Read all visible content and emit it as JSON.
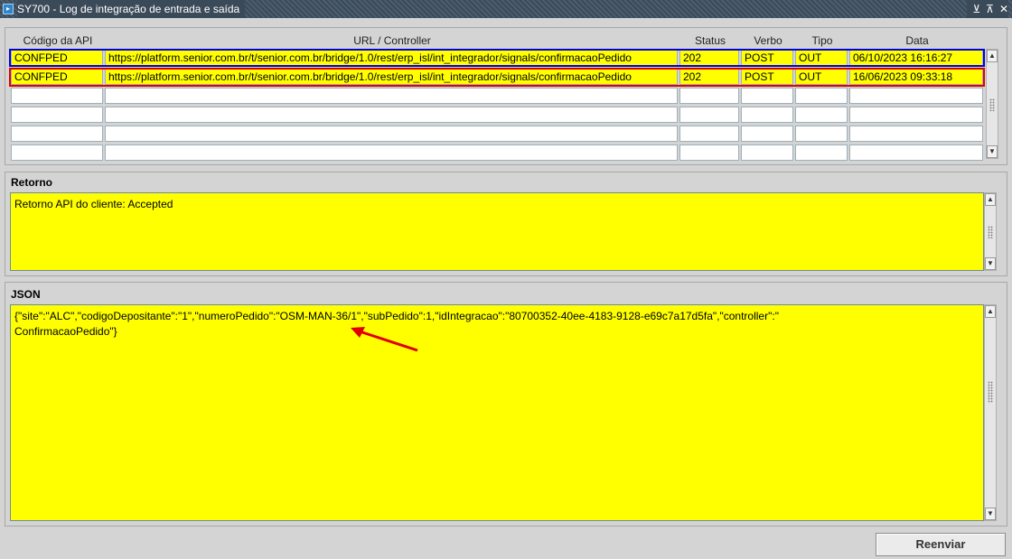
{
  "window": {
    "title": "SY700 - Log de integração de entrada e saída",
    "controls": [
      "⊻",
      "⊼",
      "✕"
    ]
  },
  "grid": {
    "columns": [
      "Código da API",
      "URL / Controller",
      "Status",
      "Verbo",
      "Tipo",
      "Data"
    ],
    "rows": [
      {
        "codigo": "CONFPED",
        "url": "https://platform.senior.com.br/t/senior.com.br/bridge/1.0/rest/erp_isl/int_integrador/signals/confirmacaoPedido",
        "status": "202",
        "verbo": "POST",
        "tipo": "OUT",
        "data": "06/10/2023 16:16:27"
      },
      {
        "codigo": "CONFPED",
        "url": "https://platform.senior.com.br/t/senior.com.br/bridge/1.0/rest/erp_isl/int_integrador/signals/confirmacaoPedido",
        "status": "202",
        "verbo": "POST",
        "tipo": "OUT",
        "data": "16/06/2023 09:33:18"
      },
      {
        "codigo": "",
        "url": "",
        "status": "",
        "verbo": "",
        "tipo": "",
        "data": ""
      },
      {
        "codigo": "",
        "url": "",
        "status": "",
        "verbo": "",
        "tipo": "",
        "data": ""
      },
      {
        "codigo": "",
        "url": "",
        "status": "",
        "verbo": "",
        "tipo": "",
        "data": ""
      },
      {
        "codigo": "",
        "url": "",
        "status": "",
        "verbo": "",
        "tipo": "",
        "data": ""
      }
    ]
  },
  "retorno": {
    "label": "Retorno",
    "value": "Retorno API do cliente: Accepted"
  },
  "json_section": {
    "label": "JSON",
    "value": "{\"site\":\"ALC\",\"codigoDepositante\":\"1\",\"numeroPedido\":\"OSM-MAN-36/1\",\"subPedido\":1,\"idIntegracao\":\"80700352-40ee-4183-9128-e69c7a17d5fa\",\"controller\":\"\nConfirmacaoPedido\"}"
  },
  "actions": {
    "reenviar_label": "Reenviar"
  },
  "colors": {
    "field_highlight": "#ffff00",
    "annotation_blue": "#0000e0",
    "annotation_red": "#e00000"
  }
}
